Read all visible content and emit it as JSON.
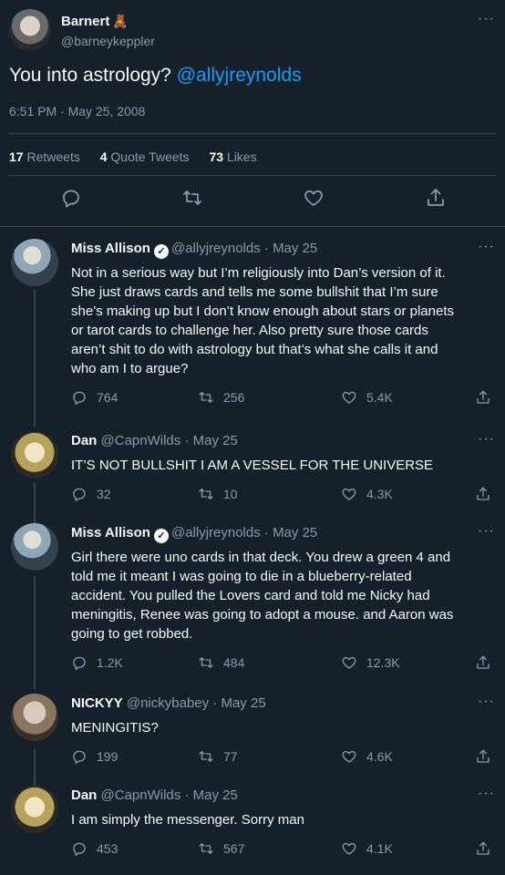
{
  "main_tweet": {
    "author_name": "Barnert",
    "author_emoji": "🧸",
    "author_handle": "@barneykeppler",
    "text_prefix": "You into astrology? ",
    "text_mention": "@allyjreynolds",
    "timestamp": "6:51 PM · May 25, 2008",
    "stats": {
      "retweets_count": "17",
      "retweets_label": "Retweets",
      "quotes_count": "4",
      "quotes_label": "Quote Tweets",
      "likes_count": "73",
      "likes_label": "Likes"
    },
    "actions": [
      "reply-icon",
      "retweet-icon",
      "like-icon",
      "share-icon"
    ]
  },
  "more_label": "···",
  "replies": [
    {
      "name": "Miss Allison",
      "verified": true,
      "handle": "@allyjreynolds",
      "date": "· May 25",
      "lines": [
        "Not in a serious way but I’m religiously into Dan’s version of it.",
        "She just draws cards and tells me some bullshit that I’m sure",
        "she’s making up but I don’t know enough about stars or planets",
        "or tarot cards to challenge her. Also pretty sure those cards",
        "aren’t shit to do with astrology but that’s what she calls it and",
        "who am I to argue?"
      ],
      "replies": "764",
      "retweets": "256",
      "likes": "5.4K"
    },
    {
      "name": "Dan",
      "verified": false,
      "handle": "@CapnWilds",
      "date": "· May 25",
      "lines": [
        "IT’S NOT BULLSHIT I AM A VESSEL FOR THE UNIVERSE"
      ],
      "replies": "32",
      "retweets": "10",
      "likes": "4.3K"
    },
    {
      "name": "Miss Allison",
      "verified": true,
      "handle": "@allyjreynolds",
      "date": "· May 25",
      "lines": [
        "Girl there were uno cards in that deck. You drew a green 4 and",
        "told me it meant I was going to die in a blueberry-related",
        "accident. You pulled the Lovers card and told me Nicky had",
        "meningitis, Renee was going to adopt a mouse. and Aaron was",
        "going to get robbed."
      ],
      "replies": "1.2K",
      "retweets": "484",
      "likes": "12.3K"
    },
    {
      "name": "NICKYY",
      "verified": false,
      "handle": "@nickybabey",
      "date": "· May 25",
      "lines": [
        "MENINGITIS?"
      ],
      "replies": "199",
      "retweets": "77",
      "likes": "4.6K"
    },
    {
      "name": "Dan",
      "verified": false,
      "handle": "@CapnWilds",
      "date": "· May 25",
      "lines": [
        "I am simply the messenger. Sorry man"
      ],
      "replies": "453",
      "retweets": "567",
      "likes": "4.1K"
    }
  ],
  "colors": {
    "background": "#15202b",
    "text": "#f7f9f9",
    "secondary": "#8b98a5",
    "link": "#1d9bf0",
    "divider": "#38444d"
  }
}
